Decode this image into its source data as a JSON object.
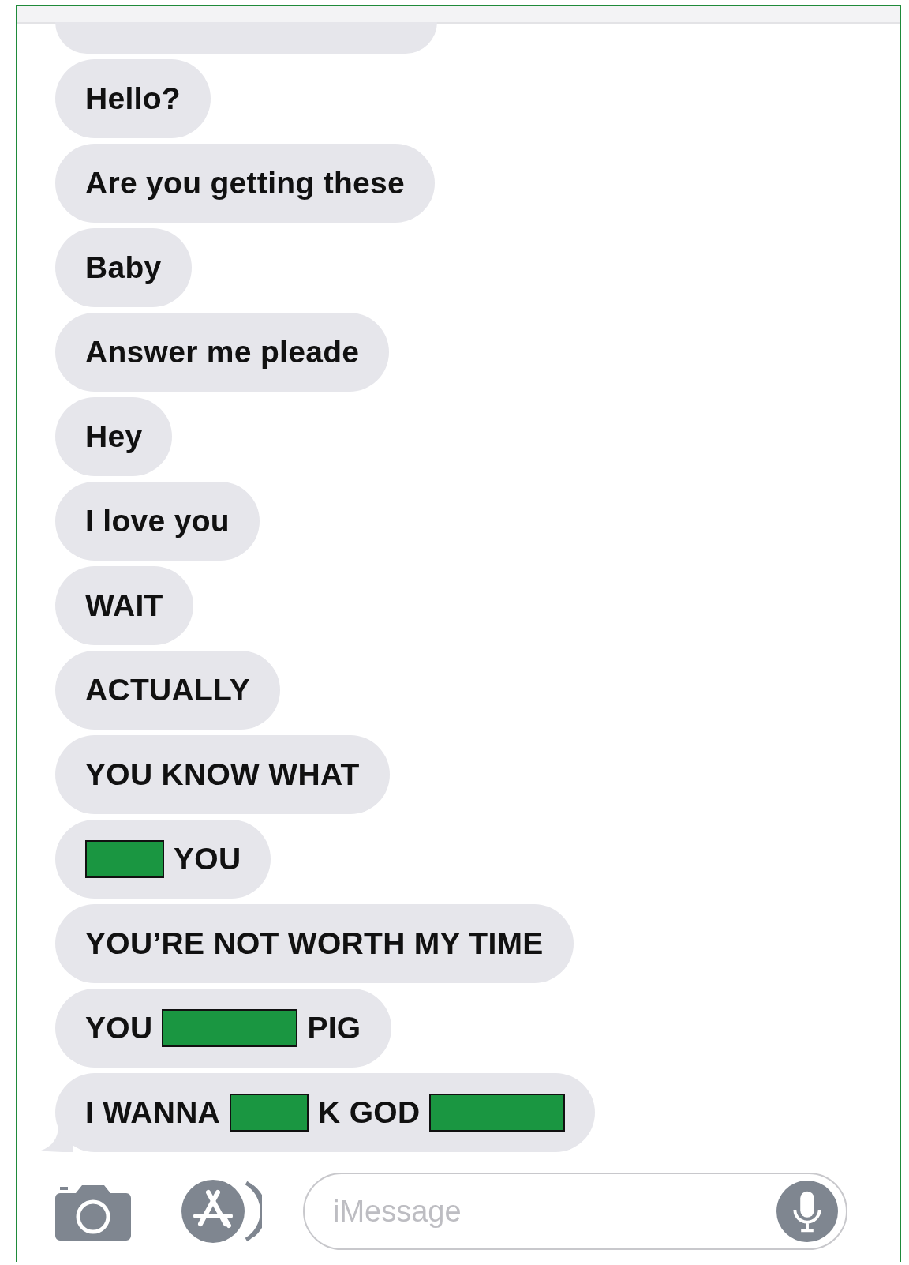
{
  "messages": [
    {
      "parts": [
        {
          "kind": "text",
          "text": "Hello?"
        }
      ]
    },
    {
      "parts": [
        {
          "kind": "text",
          "text": "Are you getting these"
        }
      ]
    },
    {
      "parts": [
        {
          "kind": "text",
          "text": "Baby"
        }
      ]
    },
    {
      "parts": [
        {
          "kind": "text",
          "text": "Answer me pleade"
        }
      ]
    },
    {
      "parts": [
        {
          "kind": "text",
          "text": "Hey"
        }
      ]
    },
    {
      "parts": [
        {
          "kind": "text",
          "text": "I love you"
        }
      ]
    },
    {
      "parts": [
        {
          "kind": "text",
          "text": "WAIT"
        }
      ]
    },
    {
      "parts": [
        {
          "kind": "text",
          "text": "ACTUALLY"
        }
      ]
    },
    {
      "parts": [
        {
          "kind": "text",
          "text": "YOU KNOW WHAT"
        }
      ]
    },
    {
      "parts": [
        {
          "kind": "redaction_short"
        },
        {
          "kind": "text",
          "text": "YOU"
        }
      ]
    },
    {
      "parts": [
        {
          "kind": "text",
          "text": "YOU’RE NOT WORTH MY TIME"
        }
      ]
    },
    {
      "parts": [
        {
          "kind": "text",
          "text": "YOU"
        },
        {
          "kind": "redaction_long"
        },
        {
          "kind": "text",
          "text": "PIG"
        }
      ]
    },
    {
      "parts": [
        {
          "kind": "text",
          "text": "I WANNA"
        },
        {
          "kind": "redaction_short"
        },
        {
          "kind": "text",
          "text": "K GOD"
        },
        {
          "kind": "redaction_long"
        }
      ]
    }
  ],
  "composer": {
    "placeholder": "iMessage"
  }
}
